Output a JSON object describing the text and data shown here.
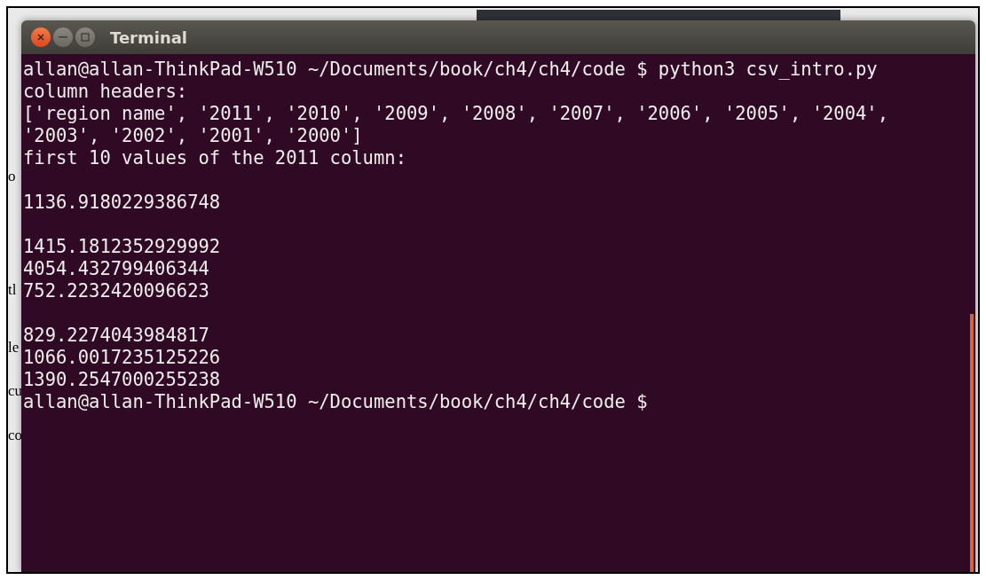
{
  "background_document": {
    "fragments": [
      "o",
      "tl",
      "le",
      "cu",
      "co"
    ]
  },
  "window": {
    "title": "Terminal"
  },
  "terminal": {
    "lines": [
      {
        "kind": "text",
        "text": "allan@allan-ThinkPad-W510 ~/Documents/book/ch4/ch4/code $ python3 csv_intro.py"
      },
      {
        "kind": "text",
        "text": "column headers:"
      },
      {
        "kind": "text",
        "text": "['region name', '2011', '2010', '2009', '2008', '2007', '2006', '2005', '2004',"
      },
      {
        "kind": "text",
        "text": "'2003', '2002', '2001', '2000']"
      },
      {
        "kind": "text",
        "text": "first 10 values of the 2011 column:"
      },
      {
        "kind": "blank"
      },
      {
        "kind": "text",
        "text": "1136.9180229386748"
      },
      {
        "kind": "blank"
      },
      {
        "kind": "text",
        "text": "1415.1812352929992"
      },
      {
        "kind": "text",
        "text": "4054.432799406344"
      },
      {
        "kind": "text",
        "text": "752.2232420096623"
      },
      {
        "kind": "blank"
      },
      {
        "kind": "text",
        "text": "829.2274043984817"
      },
      {
        "kind": "text",
        "text": "1066.0017235125226"
      },
      {
        "kind": "text",
        "text": "1390.2547000255238"
      },
      {
        "kind": "text",
        "text": "allan@allan-ThinkPad-W510 ~/Documents/book/ch4/ch4/code $"
      }
    ]
  }
}
